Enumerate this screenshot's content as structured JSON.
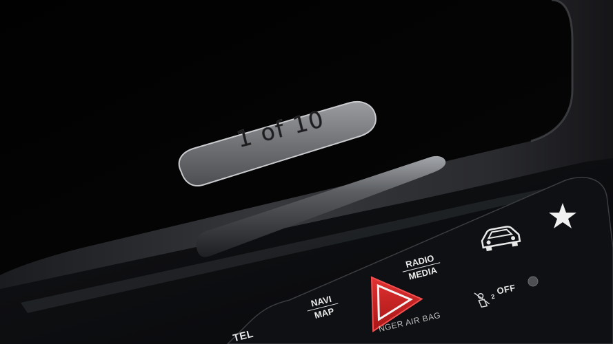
{
  "badge": {
    "text": "1 of 10"
  },
  "buttons": {
    "navi_map": {
      "top": "NAVI",
      "bottom": "MAP"
    },
    "radio_media": {
      "top": "RADIO",
      "bottom": "MEDIA"
    },
    "airbag": {
      "off_label": "OFF",
      "sub": "2"
    },
    "passenger_airbag_caption": "NGER AIR BAG",
    "tel": "TEL"
  },
  "icons": [
    "hazard-icon",
    "car-icon",
    "star-icon",
    "airbag-off-icon",
    "indicator-led"
  ],
  "colors": {
    "hazard_red": "#c41c1c",
    "trim_silver": "#8c8e91",
    "label_white": "#ececec"
  }
}
